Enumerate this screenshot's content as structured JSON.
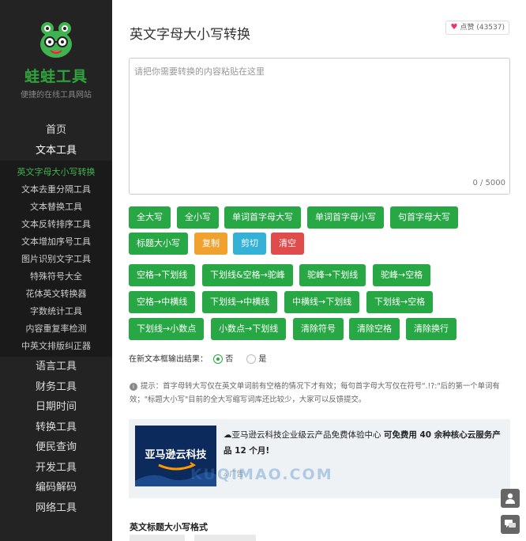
{
  "sidebar": {
    "brand": "蛙蛙工具",
    "tagline": "便捷的在线工具网站",
    "nav_top": [
      {
        "label": "首页"
      },
      {
        "label": "文本工具"
      }
    ],
    "text_tools": [
      {
        "label": "英文字母大小写转换",
        "active": true
      },
      {
        "label": "文本去重分隔工具"
      },
      {
        "label": "文本替换工具"
      },
      {
        "label": "文本反转排序工具"
      },
      {
        "label": "文本增加序号工具"
      },
      {
        "label": "图片识别文字工具"
      },
      {
        "label": "特殊符号大全"
      },
      {
        "label": "花体英文转换器"
      },
      {
        "label": "字数统计工具"
      },
      {
        "label": "内容重复率检测"
      },
      {
        "label": "中英文排版纠正器"
      }
    ],
    "nav_bottom": [
      {
        "label": "语言工具"
      },
      {
        "label": "财务工具"
      },
      {
        "label": "日期时间"
      },
      {
        "label": "转换工具"
      },
      {
        "label": "便民查询"
      },
      {
        "label": "开发工具"
      },
      {
        "label": "编码解码"
      },
      {
        "label": "网络工具"
      }
    ]
  },
  "page": {
    "title": "英文字母大小写转换",
    "like_label": "点赞",
    "like_count": "(43537)"
  },
  "editor": {
    "placeholder": "请把你需要转换的内容粘贴在这里",
    "counter": "0 / 5000"
  },
  "buttons": {
    "upper": "全大写",
    "lower": "全小写",
    "word_cap": "单词首字母大写",
    "word_low": "单词首字母小写",
    "sentence_cap": "句首字母大写",
    "title_case": "标题大小写",
    "copy": "复制",
    "cut": "剪切",
    "clear": "清空",
    "space_to_underscore": "空格→下划线",
    "underscore_space_to_camel": "下划线&空格→驼峰",
    "camel_to_underscore": "驼峰→下划线",
    "camel_to_space": "驼峰→空格",
    "space_to_dash": "空格→中横线",
    "underscore_to_dash": "下划线→中横线",
    "dash_to_underscore": "中横线→下划线",
    "underscore_to_space": "下划线→空格",
    "underscore_to_dot": "下划线→小数点",
    "dot_to_underscore": "小数点→下划线",
    "clear_symbols": "清除符号",
    "clear_spaces": "清除空格",
    "clear_newlines": "清除换行"
  },
  "output_option": {
    "label": "在新文本框输出结果：",
    "no": "否",
    "yes": "是",
    "selected": "否"
  },
  "tip": {
    "text": "提示：首字母转大写仅在英文单词前有空格的情况下才有效；每句首字母大写仅在符号\".!?:\"后的第一个单词有效；\"标题大小写\"目前的全大写缩写词库还比较少，大家可以反馈提交。"
  },
  "ad": {
    "image_text": "亚马逊云科技",
    "title_prefix": "亚马逊云科技企业级云产品免费体验中心",
    "title_bold": "可免费用 40 余种核心云服务产品 12 个月!",
    "tag": "广告"
  },
  "watermark": "KUQIMAO.COM",
  "section": {
    "heading": "英文标题大小写格式"
  },
  "colors": {
    "sidebar_bg": "#232323",
    "brand_green": "#2ea33c",
    "button_green": "#27a844",
    "button_orange": "#f0a22e",
    "button_teal": "#33b1d6",
    "button_red": "#e04b4b"
  },
  "float_icons": [
    "user-icon",
    "chat-icon"
  ]
}
